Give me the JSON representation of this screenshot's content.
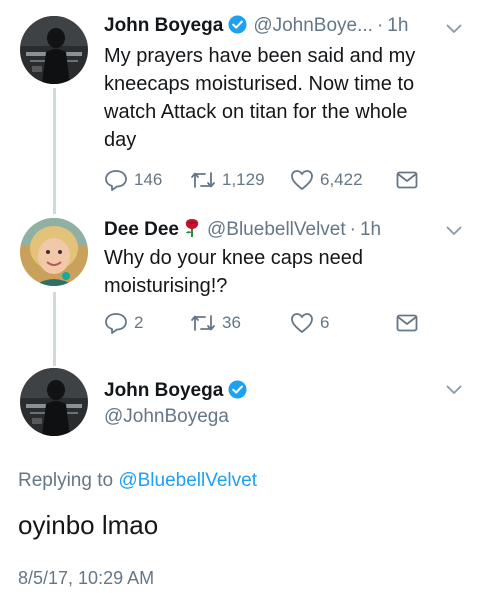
{
  "tweet1": {
    "name": "John Boyega",
    "handle": "@JohnBoye...",
    "dot": "·",
    "time": "1h",
    "lines": [
      "My prayers have been said and my",
      "kneecaps moisturised. Now time to",
      "watch Attack on titan for the whole",
      "day"
    ],
    "replies": "146",
    "retweets": "1,129",
    "likes": "6,422"
  },
  "tweet2": {
    "name": "Dee Dee",
    "handle": "@BluebellVelvet",
    "dot": "·",
    "time": "1h",
    "lines": [
      "Why do your knee caps need",
      "moisturising!?"
    ],
    "replies": "2",
    "retweets": "36",
    "likes": "6"
  },
  "tweet3": {
    "name": "John Boyega",
    "handle": "@JohnBoyega",
    "replying_prefix": "Replying to",
    "replying_mention": "@BluebellVelvet",
    "text": "oyinbo lmao",
    "timestamp": "8/5/17, 10:29 AM"
  },
  "colors": {
    "accent": "#1da1f2",
    "muted": "#657786",
    "text": "#14171a",
    "thread_line": "#cfd9de"
  },
  "icons": [
    "verified-badge-icon",
    "rose-emoji-icon",
    "chevron-down-icon",
    "reply-icon",
    "retweet-icon",
    "like-icon",
    "dm-icon"
  ]
}
